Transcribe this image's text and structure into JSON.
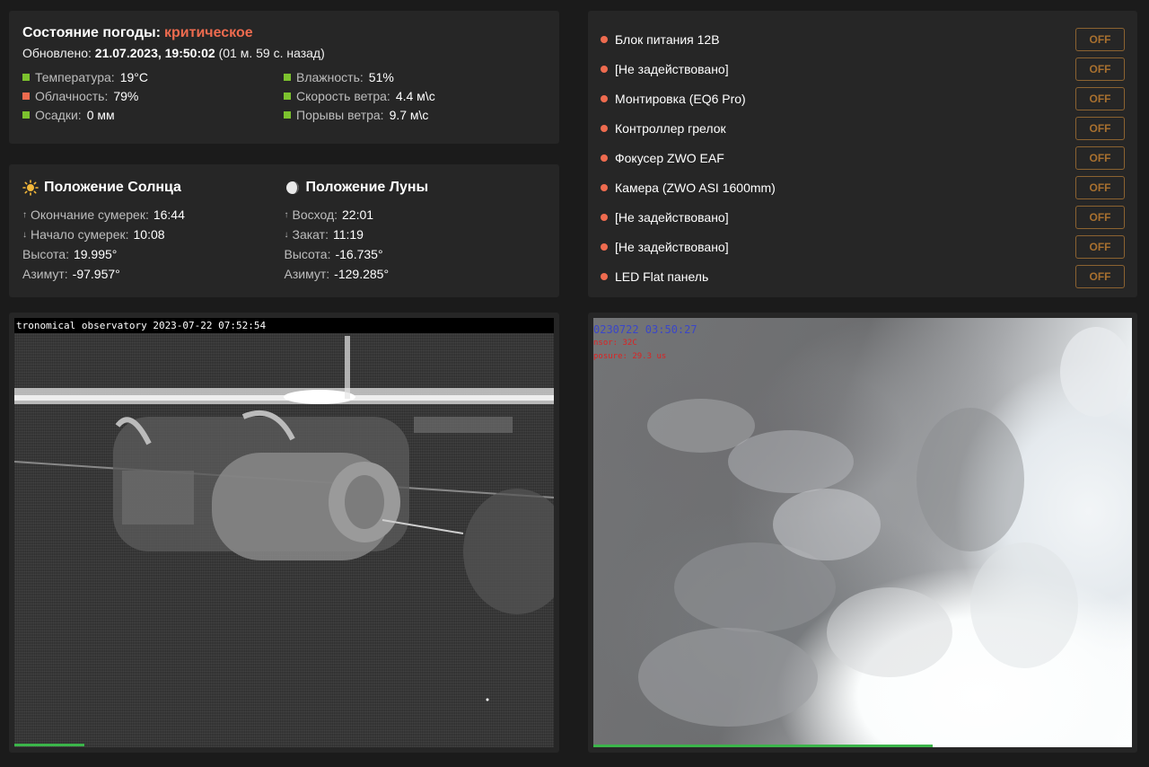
{
  "weather": {
    "title": "Состояние погоды:",
    "status": "критическое",
    "updated_label": "Обновлено:",
    "updated_value": "21.07.2023, 19:50:02",
    "updated_ago": "(01 м. 59 с. назад)",
    "items": [
      {
        "label": "Температура:",
        "value": "19°C",
        "color": "#7cc22e"
      },
      {
        "label": "Влажность:",
        "value": "51%",
        "color": "#7cc22e"
      },
      {
        "label": "Облачность:",
        "value": "79%",
        "color": "#ee6b4f"
      },
      {
        "label": "Скорость ветра:",
        "value": "4.4 м\\с",
        "color": "#7cc22e"
      },
      {
        "label": "Осадки:",
        "value": "0 мм",
        "color": "#7cc22e"
      },
      {
        "label": "Порывы ветра:",
        "value": "9.7 м\\с",
        "color": "#7cc22e"
      }
    ]
  },
  "sun": {
    "title": "Положение Солнца",
    "icon": "sun-icon",
    "rows": [
      {
        "arrow": "↑",
        "label": "Окончание сумерек:",
        "value": "16:44"
      },
      {
        "arrow": "↓",
        "label": "Начало сумерек:",
        "value": "10:08"
      },
      {
        "arrow": "",
        "label": "Высота:",
        "value": "19.995°"
      },
      {
        "arrow": "",
        "label": "Азимут:",
        "value": "-97.957°"
      }
    ]
  },
  "moon": {
    "title": "Положение Луны",
    "icon": "moon-icon",
    "rows": [
      {
        "arrow": "↑",
        "label": "Восход:",
        "value": "22:01"
      },
      {
        "arrow": "↓",
        "label": "Закат:",
        "value": "11:19"
      },
      {
        "arrow": "",
        "label": "Высота:",
        "value": "-16.735°"
      },
      {
        "arrow": "",
        "label": "Азимут:",
        "value": "-129.285°"
      }
    ]
  },
  "power": {
    "items": [
      {
        "label": "Блок питания 12В",
        "button": "OFF"
      },
      {
        "label": "[Не задействовано]",
        "button": "OFF"
      },
      {
        "label": "Монтировка (EQ6 Pro)",
        "button": "OFF"
      },
      {
        "label": "Контроллер грелок",
        "button": "OFF"
      },
      {
        "label": "Фокусер ZWO EAF",
        "button": "OFF"
      },
      {
        "label": "Камера (ZWO ASI 1600mm)",
        "button": "OFF"
      },
      {
        "label": "[Не задействовано]",
        "button": "OFF"
      },
      {
        "label": "[Не задействовано]",
        "button": "OFF"
      },
      {
        "label": "LED Flat панель",
        "button": "OFF"
      }
    ],
    "dot_color": "#ee6b4f"
  },
  "cam_left": {
    "header": "tronomical observatory 2023-07-22 07:52:54",
    "progress": 0.13
  },
  "cam_right": {
    "timestamp": "0230722  03:50:27",
    "sensor": "nsor:   32C",
    "exposure": "posure: 29.3 us",
    "progress": 0.63
  }
}
